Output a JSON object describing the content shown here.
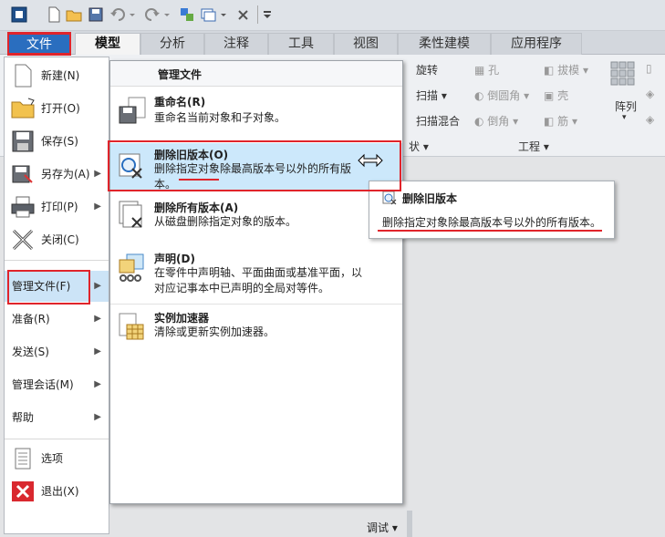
{
  "tabs": [
    "文件",
    "模型",
    "分析",
    "注释",
    "工具",
    "视图",
    "柔性建模",
    "应用程序"
  ],
  "ribbon": {
    "col1": [
      "旋转",
      "扫描",
      "扫描混合"
    ],
    "col2": [
      "孔",
      "倒圆角",
      "倒角"
    ],
    "col3": [
      "拔模",
      "壳",
      "筋"
    ],
    "pattern": "阵列",
    "group_shape": "状",
    "group_engineering": "工程"
  },
  "file_menu": {
    "items": [
      {
        "label": "新建(N)",
        "icon": "new-file-icon"
      },
      {
        "label": "打开(O)",
        "icon": "open-folder-icon"
      },
      {
        "label": "保存(S)",
        "icon": "save-icon"
      },
      {
        "label": "另存为(A)",
        "icon": "save-as-icon"
      },
      {
        "label": "打印(P)",
        "icon": "print-icon"
      },
      {
        "label": "关闭(C)",
        "icon": "close-icon"
      }
    ],
    "submenus": [
      "管理文件(F)",
      "准备(R)",
      "发送(S)",
      "管理会话(M)",
      "帮助"
    ],
    "options": "选项",
    "exit": "退出(X)"
  },
  "submenu": {
    "header": "管理文件",
    "items": [
      {
        "title": "重命名(R)",
        "desc": "重命名当前对象和子对象。"
      },
      {
        "title": "删除旧版本(O)",
        "desc": "删除指定对象除最高版本号以外的所有版本。"
      },
      {
        "title": "删除所有版本(A)",
        "desc": "从磁盘删除指定对象的版本。"
      },
      {
        "title": "声明(D)",
        "desc": "在零件中声明轴、平面曲面或基准平面，以对应记事本中已声明的全局对等件。"
      },
      {
        "title": "实例加速器",
        "desc": "清除或更新实例加速器。"
      }
    ]
  },
  "tooltip": {
    "title": "删除旧版本",
    "desc": "删除指定对象除最高版本号以外的所有版本。"
  },
  "footer": {
    "debug": "调试"
  }
}
